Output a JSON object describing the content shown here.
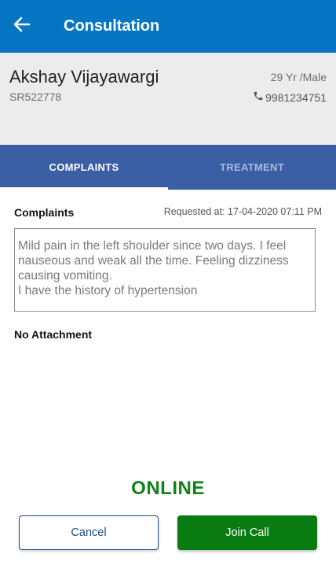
{
  "appbar": {
    "title": "Consultation",
    "back_icon": "arrow-left-icon"
  },
  "patient": {
    "name": "Akshay Vijayawargi",
    "id": "SR522778",
    "age_gender": "29 Yr /Male",
    "phone": "9981234751",
    "phone_icon": "phone-icon"
  },
  "tabs": [
    {
      "label": "COMPLAINTS",
      "active": true
    },
    {
      "label": "TREATMENT",
      "active": false
    }
  ],
  "complaints": {
    "heading": "Complaints",
    "requested_at": "Requested at: 17-04-2020 07:11 PM",
    "text": "Mild pain in the left shoulder since two days. I feel nauseous and weak all the time. Feeling dizziness causing vomiting.\nI have the history of hypertension"
  },
  "attachment": {
    "label": "No Attachment"
  },
  "status": {
    "text": "ONLINE",
    "color": "#10821b"
  },
  "actions": {
    "cancel_label": "Cancel",
    "join_label": "Join Call"
  },
  "colors": {
    "primary": "#0575c4",
    "tab_bar": "#3a5fa4",
    "success": "#0a7d12"
  }
}
